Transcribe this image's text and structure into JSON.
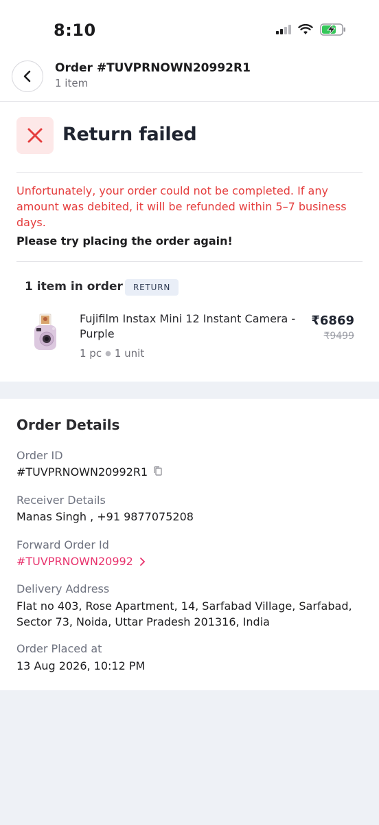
{
  "status_bar": {
    "time": "8:10"
  },
  "header": {
    "title": "Order #TUVPRNOWN20992R1",
    "subtitle": "1 item"
  },
  "status": {
    "title": "Return failed",
    "message": "Unfortunately, your order could not be completed. If any amount was debited, it will be refunded within 5–7 business days.",
    "retry_message": "Please try placing the order again!"
  },
  "items": {
    "title": "1 item in order",
    "badge": "RETURN",
    "list": [
      {
        "name": "Fujifilm Instax Mini 12 Instant Camera - Purple",
        "qty": "1 pc",
        "unit": "1 unit",
        "price": "₹6869",
        "original_price": "₹9499"
      }
    ]
  },
  "order_details": {
    "title": "Order Details",
    "order_id_label": "Order ID",
    "order_id_value": "#TUVPRNOWN20992R1",
    "receiver_label": "Receiver Details",
    "receiver_value": "Manas Singh , +91 9877075208",
    "forward_label": "Forward Order Id",
    "forward_value": "#TUVPRNOWN20992",
    "address_label": "Delivery Address",
    "address_value": "Flat no 403, Rose Apartment, 14, Sarfabad Village, Sarfabad, Sector 73, Noida, Uttar Pradesh 201316, India",
    "placed_label": "Order Placed at",
    "placed_value": "13 Aug 2026, 10:12 PM"
  },
  "colors": {
    "error": "#e53e3e",
    "link": "#e8336d",
    "background": "#eef1f6"
  },
  "icons": [
    "signal-icon",
    "wifi-icon",
    "battery-charging-icon",
    "back-arrow-icon",
    "close-icon",
    "copy-icon",
    "chevron-right-icon",
    "camera-product-image"
  ]
}
